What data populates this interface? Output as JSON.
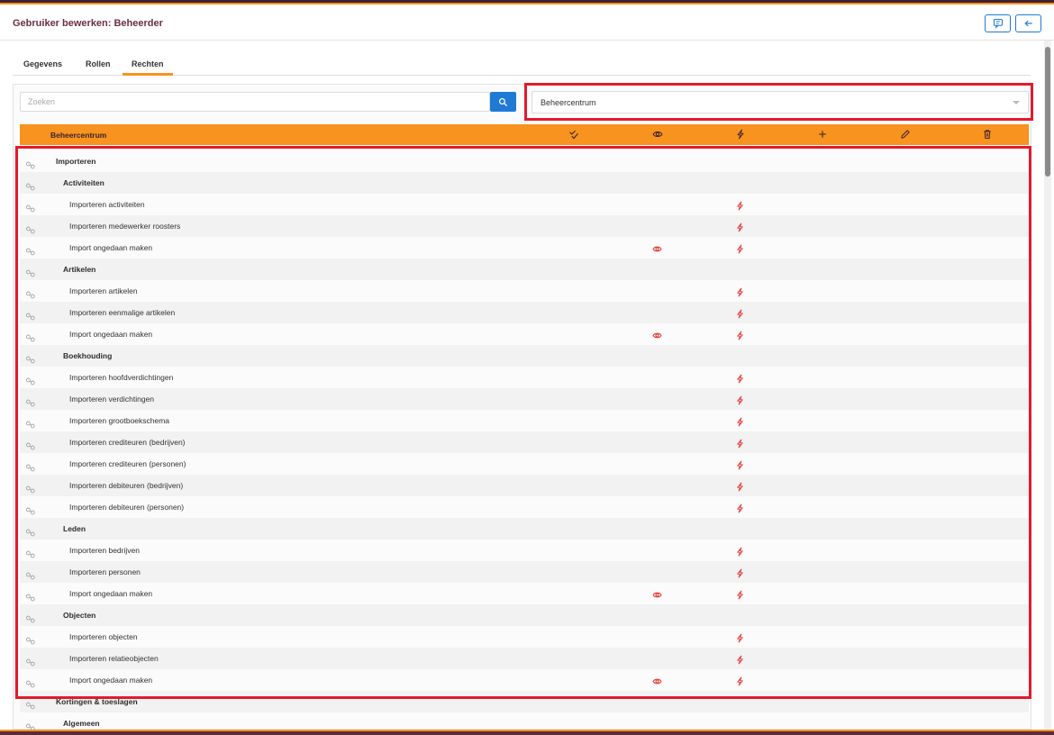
{
  "header": {
    "title": "Gebruiker bewerken: Beheerder",
    "feedback_icon": "message-square-icon",
    "back_icon": "arrow-left-icon"
  },
  "tabs": [
    {
      "label": "Gegevens",
      "active": false
    },
    {
      "label": "Rollen",
      "active": false
    },
    {
      "label": "Rechten",
      "active": true
    }
  ],
  "search": {
    "placeholder": "Zoeken",
    "value": "",
    "icon": "search-icon"
  },
  "module_select": {
    "value": "Beheercentrum"
  },
  "table_header": {
    "label": "Beheercentrum",
    "columns": [
      {
        "icon": "check-all-icon",
        "name": "all"
      },
      {
        "icon": "eye-icon",
        "name": "view"
      },
      {
        "icon": "execute-icon",
        "name": "execute"
      },
      {
        "icon": "plus-icon",
        "name": "add"
      },
      {
        "icon": "pencil-icon",
        "name": "edit"
      },
      {
        "icon": "trash-icon",
        "name": "delete"
      }
    ]
  },
  "colors": {
    "accent": "#f7931e",
    "primary": "#1f7ad6",
    "title": "#6b2d46",
    "permission": "#e53935",
    "highlight": "#e11b2c"
  },
  "rows": [
    {
      "label": "Importeren",
      "level": 0,
      "view": false,
      "execute": false
    },
    {
      "label": "Activiteiten",
      "level": 1,
      "view": false,
      "execute": false
    },
    {
      "label": "Importeren activiteiten",
      "level": 2,
      "view": false,
      "execute": true
    },
    {
      "label": "Importeren medewerker roosters",
      "level": 2,
      "view": false,
      "execute": true
    },
    {
      "label": "Import ongedaan maken",
      "level": 2,
      "view": true,
      "execute": true
    },
    {
      "label": "Artikelen",
      "level": 1,
      "view": false,
      "execute": false
    },
    {
      "label": "Importeren artikelen",
      "level": 2,
      "view": false,
      "execute": true
    },
    {
      "label": "Importeren eenmalige artikelen",
      "level": 2,
      "view": false,
      "execute": true
    },
    {
      "label": "Import ongedaan maken",
      "level": 2,
      "view": true,
      "execute": true
    },
    {
      "label": "Boekhouding",
      "level": 1,
      "view": false,
      "execute": false
    },
    {
      "label": "Importeren hoofdverdichtingen",
      "level": 2,
      "view": false,
      "execute": true
    },
    {
      "label": "Importeren verdichtingen",
      "level": 2,
      "view": false,
      "execute": true
    },
    {
      "label": "Importeren grootboekschema",
      "level": 2,
      "view": false,
      "execute": true
    },
    {
      "label": "Importeren crediteuren (bedrijven)",
      "level": 2,
      "view": false,
      "execute": true
    },
    {
      "label": "Importeren crediteuren (personen)",
      "level": 2,
      "view": false,
      "execute": true
    },
    {
      "label": "Importeren debiteuren (bedrijven)",
      "level": 2,
      "view": false,
      "execute": true
    },
    {
      "label": "Importeren debiteuren (personen)",
      "level": 2,
      "view": false,
      "execute": true
    },
    {
      "label": "Leden",
      "level": 1,
      "view": false,
      "execute": false
    },
    {
      "label": "Importeren bedrijven",
      "level": 2,
      "view": false,
      "execute": true
    },
    {
      "label": "Importeren personen",
      "level": 2,
      "view": false,
      "execute": true
    },
    {
      "label": "Import ongedaan maken",
      "level": 2,
      "view": true,
      "execute": true
    },
    {
      "label": "Objecten",
      "level": 1,
      "view": false,
      "execute": false
    },
    {
      "label": "Importeren objecten",
      "level": 2,
      "view": false,
      "execute": true
    },
    {
      "label": "Importeren relatieobjecten",
      "level": 2,
      "view": false,
      "execute": true
    },
    {
      "label": "Import ongedaan maken",
      "level": 2,
      "view": true,
      "execute": true
    },
    {
      "label": "Kortingen & toeslagen",
      "level": 0,
      "view": false,
      "execute": false
    },
    {
      "label": "Algemeen",
      "level": 1,
      "view": false,
      "execute": false
    }
  ]
}
